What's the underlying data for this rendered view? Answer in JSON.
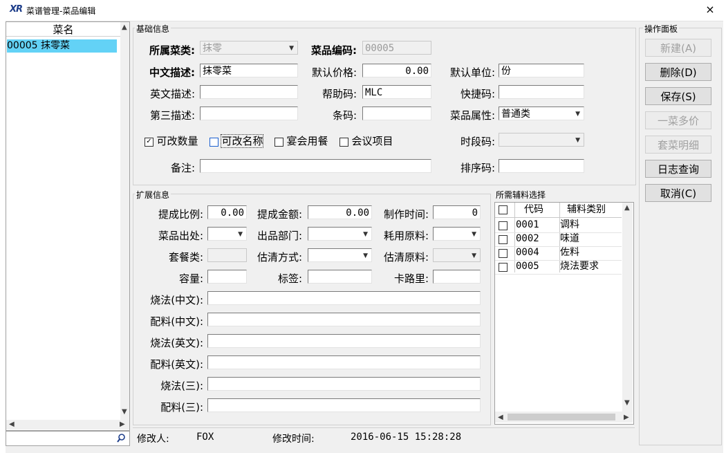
{
  "window": {
    "title": "菜谱管理-菜品编辑",
    "logo": "XR",
    "close": "×"
  },
  "list": {
    "header": "菜名",
    "rows": [
      "00005 抹零菜"
    ]
  },
  "basic": {
    "group": "基础信息",
    "category_label": "所属菜类:",
    "category_value": "抹零",
    "code_label": "菜品编码:",
    "code_value": "00005",
    "cn_desc_label": "中文描述:",
    "cn_desc_value": "抹零菜",
    "price_label": "默认价格:",
    "price_value": "0.00",
    "unit_label": "默认单位:",
    "unit_value": "份",
    "en_desc_label": "英文描述:",
    "en_desc_value": "",
    "help_label": "帮助码:",
    "help_value": "MLC",
    "quick_label": "快捷码:",
    "quick_value": "",
    "third_desc_label": "第三描述:",
    "third_desc_value": "",
    "barcode_label": "条码:",
    "barcode_value": "",
    "attr_label": "菜品属性:",
    "attr_value": "普通类",
    "chk_qty": "可改数量",
    "chk_name": "可改名称",
    "chk_banquet": "宴会用餐",
    "chk_meeting": "会议项目",
    "period_label": "时段码:",
    "period_value": "",
    "note_label": "备注:",
    "note_value": "",
    "sort_label": "排序码:",
    "sort_value": ""
  },
  "ext": {
    "group": "扩展信息",
    "ratio_label": "提成比例:",
    "ratio_value": "0.00",
    "amount_label": "提成金额:",
    "amount_value": "0.00",
    "time_label": "制作时间:",
    "time_value": "0",
    "origin_label": "菜品出处:",
    "dept_label": "出品部门:",
    "material_label": "耗用原料:",
    "set_label": "套餐类:",
    "clear_label": "估清方式:",
    "clear_mat_label": "估清原料:",
    "capacity_label": "容量:",
    "tag_label": "标签:",
    "cal_label": "卡路里:",
    "rows": [
      {
        "label": "烧法(中文):"
      },
      {
        "label": "配料(中文):"
      },
      {
        "label": "烧法(英文):"
      },
      {
        "label": "配料(英文):"
      },
      {
        "label": "烧法(三):"
      },
      {
        "label": "配料(三):"
      }
    ]
  },
  "aux": {
    "group": "所需辅料选择",
    "col_code": "代码",
    "col_type": "辅料类别",
    "rows": [
      {
        "code": "0001",
        "type": "调料"
      },
      {
        "code": "0002",
        "type": "味道"
      },
      {
        "code": "0004",
        "type": "佐料"
      },
      {
        "code": "0005",
        "type": "烧法要求"
      }
    ]
  },
  "panel": {
    "group": "操作面板",
    "new": "新建(A)",
    "delete": "删除(D)",
    "save": "保存(S)",
    "multi_price": "一菜多价",
    "set_detail": "套菜明细",
    "log": "日志查询",
    "cancel": "取消(C)"
  },
  "status": {
    "modifier_label": "修改人:",
    "modifier_value": "FOX",
    "time_label": "修改时间:",
    "time_value": "2016-06-15 15:28:28"
  }
}
